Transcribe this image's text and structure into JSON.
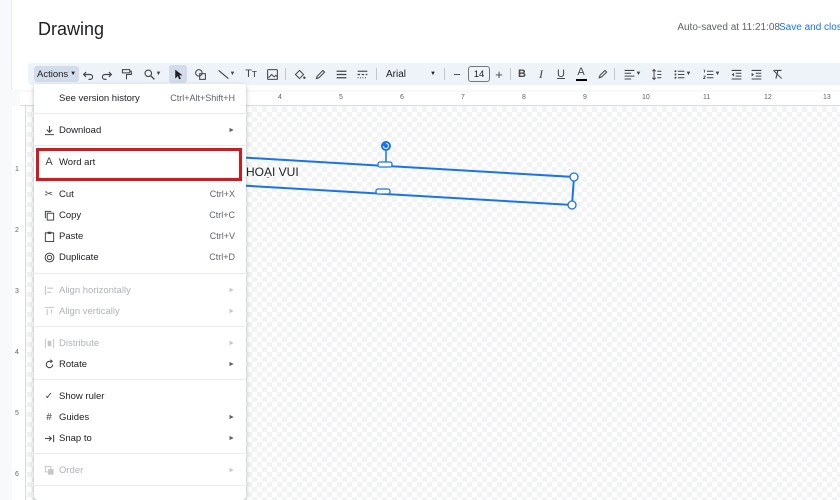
{
  "header": {
    "title": "Drawing",
    "autosave": "Auto-saved at 11:21:08",
    "save_close": "Save and close"
  },
  "toolbar": {
    "actions_label": "Actions",
    "font": "Arial",
    "font_size": "14",
    "bold": "B",
    "italic": "I",
    "underline": "U",
    "text_color": "A",
    "text_tool": "Tт"
  },
  "ruler": {
    "h_labels": [
      "4",
      "5",
      "6",
      "7",
      "8",
      "9",
      "10",
      "11",
      "12",
      "13"
    ],
    "v_labels": [
      "1",
      "2",
      "3",
      "4",
      "5",
      "6"
    ]
  },
  "canvas": {
    "shape_text": "HOẠI VUI"
  },
  "menu": {
    "items": [
      {
        "label": "See version history",
        "shortcut": "Ctrl+Alt+Shift+H"
      },
      {
        "label": "Download"
      },
      {
        "label": "Word art"
      },
      {
        "label": "Cut",
        "shortcut": "Ctrl+X"
      },
      {
        "label": "Copy",
        "shortcut": "Ctrl+C"
      },
      {
        "label": "Paste",
        "shortcut": "Ctrl+V"
      },
      {
        "label": "Duplicate",
        "shortcut": "Ctrl+D"
      },
      {
        "label": "Align horizontally"
      },
      {
        "label": "Align vertically"
      },
      {
        "label": "Distribute"
      },
      {
        "label": "Rotate"
      },
      {
        "label": "Show ruler"
      },
      {
        "label": "Guides"
      },
      {
        "label": "Snap to"
      },
      {
        "label": "Order"
      }
    ]
  },
  "colors": {
    "accent": "#1a73e8",
    "highlight": "#d11a1f",
    "toolbar_bg": "#eef2f9"
  }
}
